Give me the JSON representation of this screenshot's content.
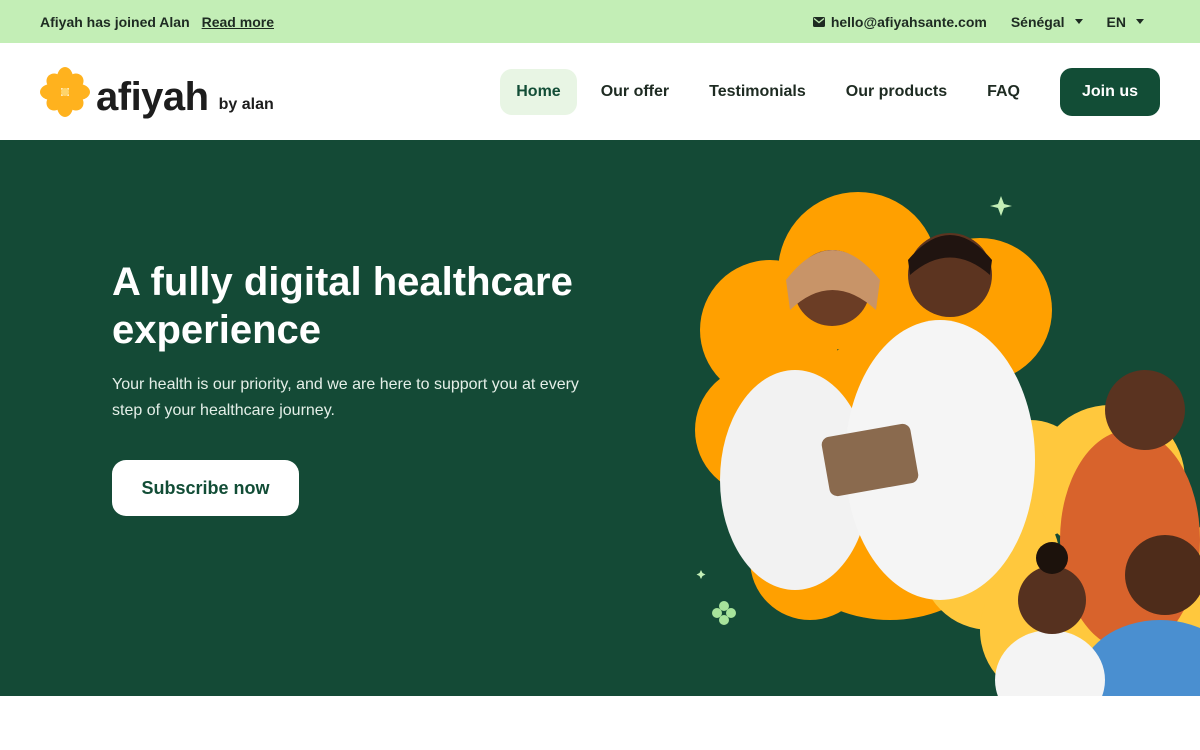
{
  "topbar": {
    "announcement": "Afiyah has joined Alan",
    "read_more": "Read more",
    "email": "hello@afiyahsante.com",
    "country": "Sénégal",
    "language": "EN",
    "mail_icon": "envelope-icon"
  },
  "header": {
    "logo_word": "afiyah",
    "logo_sub": "by alan",
    "logo_icon": "flower-icon",
    "nav": [
      "Home",
      "Our offer",
      "Testimonials",
      "Our products",
      "FAQ"
    ],
    "join_label": "Join us"
  },
  "hero": {
    "title": "A fully digital healthcare experience",
    "subtitle": "Your health is our priority, and we are here to support you at every step of your healthcare journey.",
    "cta_label": "Subscribe now"
  },
  "colors": {
    "brand_dark_green": "#144a36",
    "topbar_green": "#c3eeb6",
    "accent_orange": "#ffa000",
    "accent_yellow": "#ffc83d"
  }
}
